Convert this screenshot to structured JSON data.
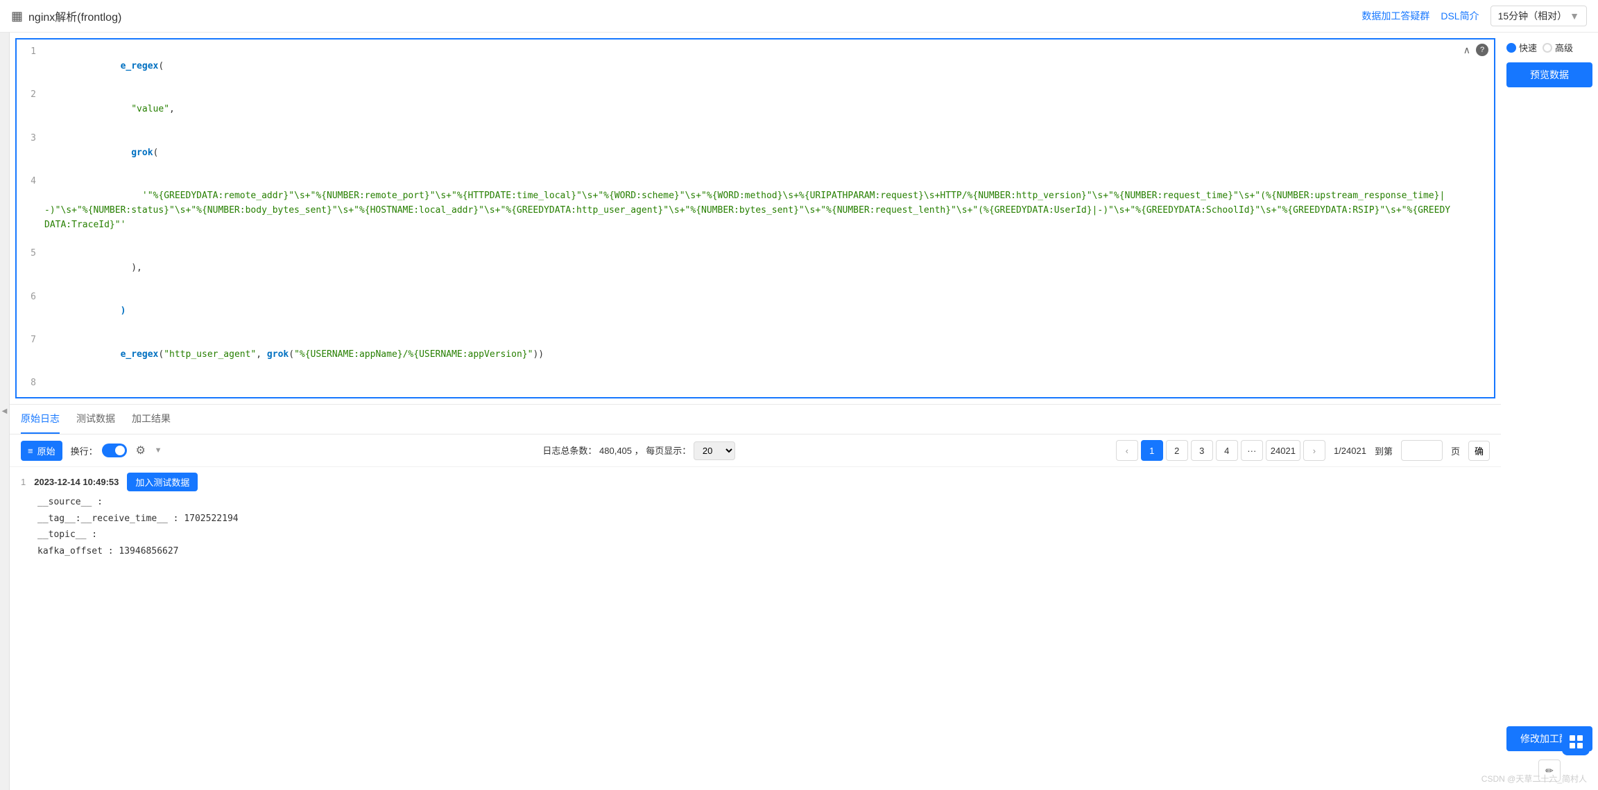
{
  "header": {
    "icon": "▦",
    "title": "nginx解析(frontlog)",
    "links": [
      "数据加工答疑群",
      "DSL简介"
    ],
    "time_selector": "15分钟（相对）"
  },
  "right_panel": {
    "speed_label": "快速",
    "advanced_label": "高级",
    "preview_btn": "预览数据",
    "modify_btn": "修改加工配置"
  },
  "code_editor": {
    "lines": [
      {
        "num": 1,
        "content": "e_regex("
      },
      {
        "num": 2,
        "content": "  \"value\","
      },
      {
        "num": 3,
        "content": "  grok("
      },
      {
        "num": 4,
        "content": "    '\"%{GREEDYDATA:remote_addr}\"\\s+\"%{NUMBER:remote_port}\"\\s+\"%{HTTPDATE:time_local}\"\\s+\"%{WORD:scheme}\"\\s+\"%{WORD:method}\\s+%{URIPATHPARAM:request}\\s+HTTP/%{NUMBER:http_version}\"\\s+\"%{NUMBER:request_time}\"\\s+\"(%{NUMBER:upstream_response_time}|-)\"\\s+\"%{NUMBER:status}\"\\s+\"%{NUMBER:body_bytes_sent}\"\\s+\"%{HOSTNAME:local_addr}\"\\s+\"%{GREEDYDATA:http_user_agent}\"\\s+\"%{NUMBER:bytes_sent}\"\\s+\"%{NUMBER:request_lenth}\"\\s+\"(%{GREEDYDATA:UserId}|-)\"\\s+\"%{GREEDYDATA:SchoolId}\"\\s+\"%{GREEDYDATA:RSIP}\"\\s+\"%{GREEDYDATA:TraceId}\"'"
      },
      {
        "num": 5,
        "content": "  ),"
      },
      {
        "num": 6,
        "content": ")"
      },
      {
        "num": 7,
        "content": "e_regex(\"http_user_agent\", grok(\"%{USERNAME:appName}/%{USERNAME:appVersion}\"))"
      },
      {
        "num": 8,
        "content": ""
      }
    ]
  },
  "log_tabs": {
    "tabs": [
      "原始日志",
      "测试数据",
      "加工结果"
    ],
    "active": "原始日志"
  },
  "log_toolbar": {
    "original_btn": "原始",
    "row_label": "换行：",
    "stats_label": "日志总条数：",
    "stats_count": "480,405",
    "per_page_label": "每页显示：",
    "per_page_value": "20",
    "pages": [
      "1",
      "2",
      "3",
      "4",
      "...",
      "24021"
    ],
    "page_input": "1/24021",
    "goto_label": "到第",
    "page_unit": "页",
    "confirm_label": "确"
  },
  "log_entries": [
    {
      "index": "1",
      "timestamp": "2023-12-14 10:49:53",
      "add_btn": "加入测试数据",
      "fields": [
        {
          "key": "__source__",
          "sep": " :",
          "value": ""
        },
        {
          "key": "__tag__:__receive_time__",
          "sep": " :",
          "value": "1702522194"
        },
        {
          "key": "__topic__",
          "sep": " :",
          "value": ""
        },
        {
          "key": "kafka_offset",
          "sep": " :",
          "value": "13946856627"
        }
      ]
    }
  ],
  "footer": {
    "watermark": "CSDN @天草二十六_简村人"
  }
}
